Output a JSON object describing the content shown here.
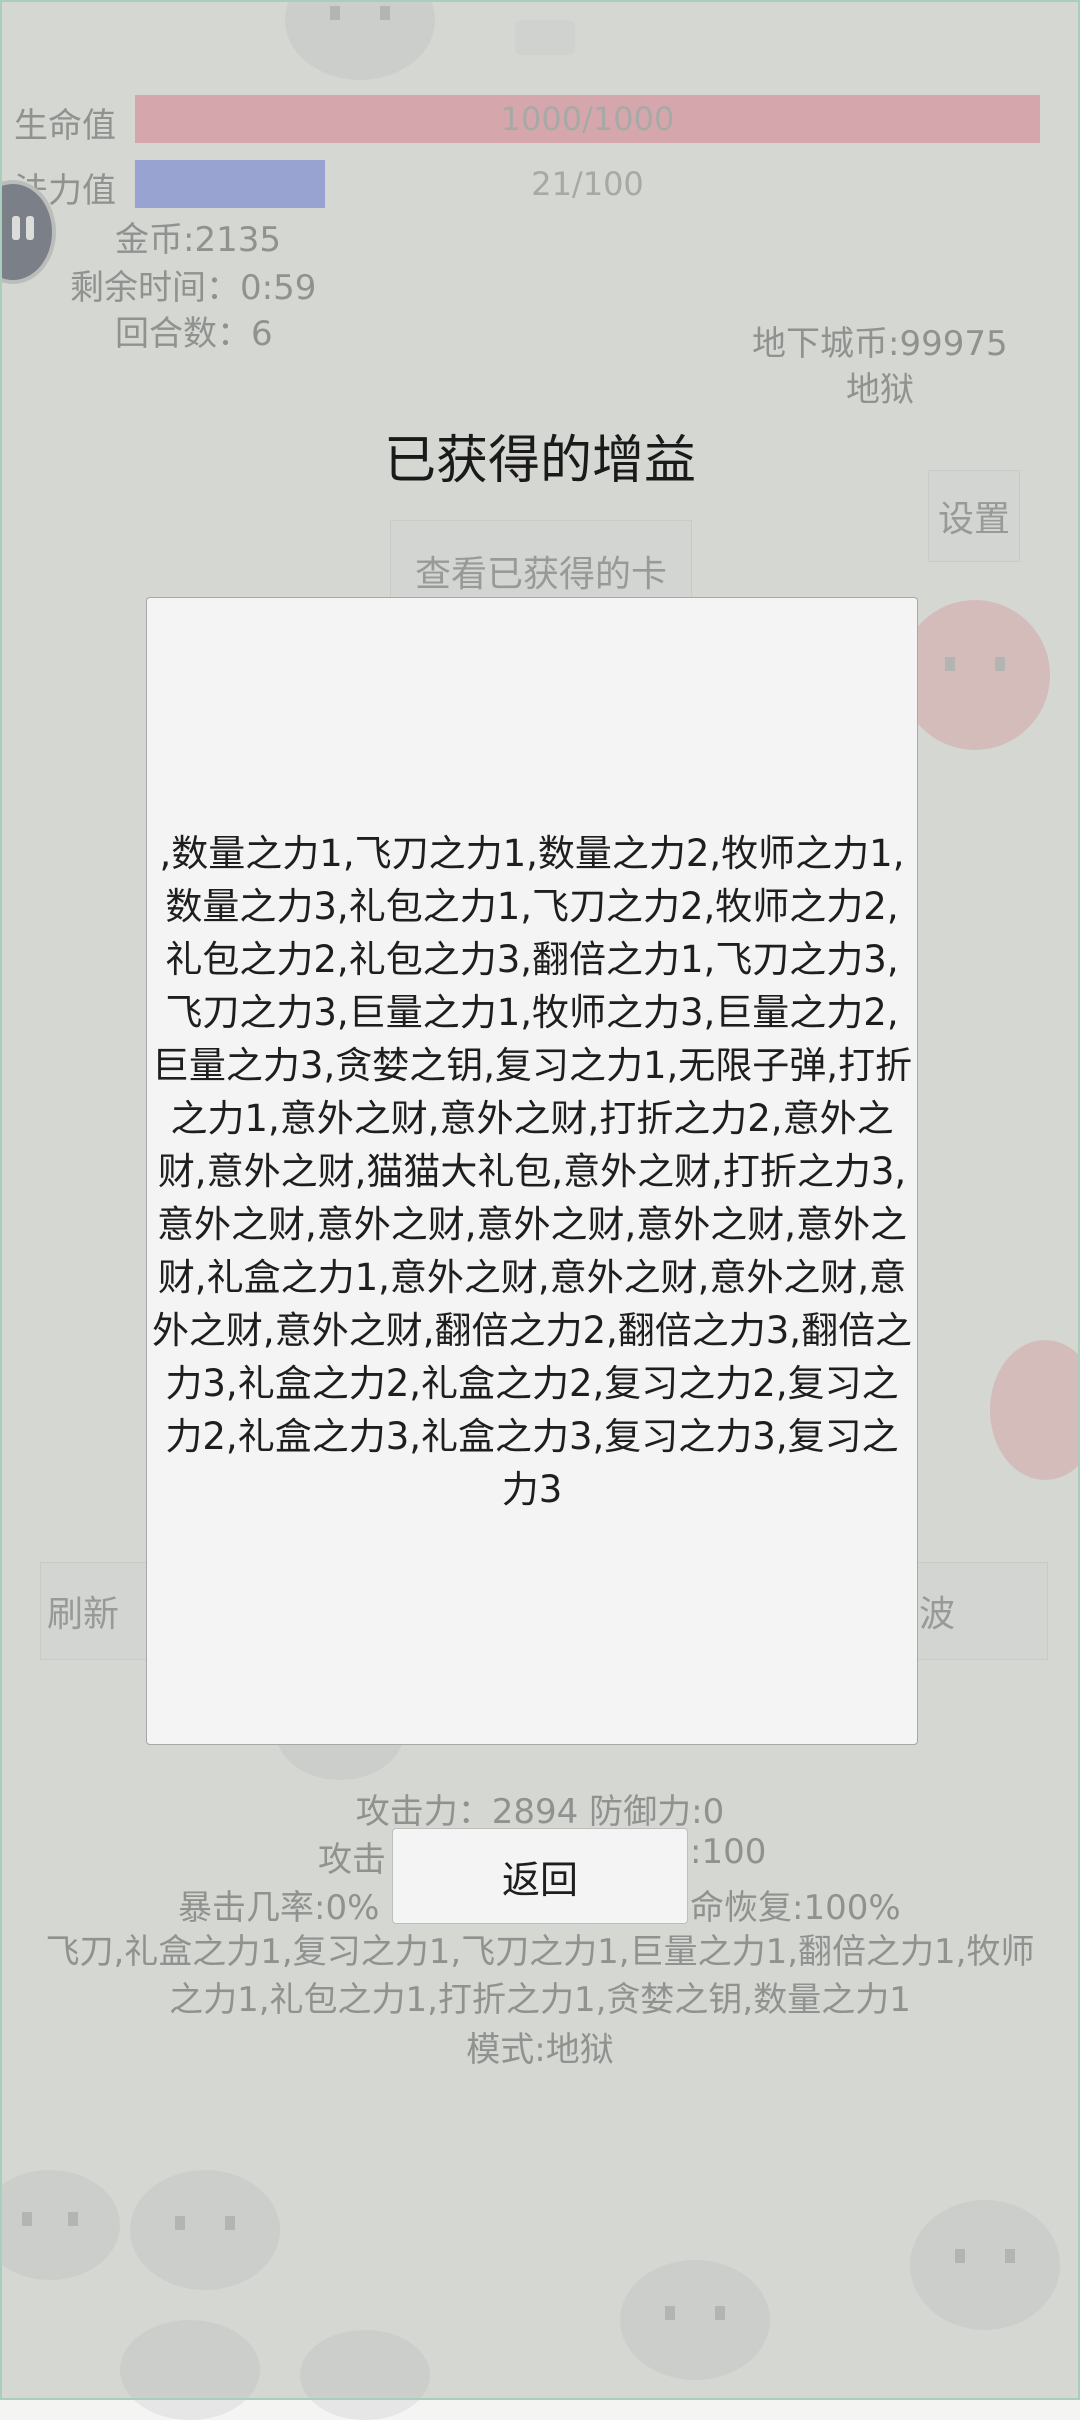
{
  "hud": {
    "hp_label": "生命值",
    "hp_text": "1000/1000",
    "hp_fraction": 1.0,
    "mp_label": "法力值",
    "mp_text": "21/100",
    "mp_fraction": 0.21,
    "gold": "金币:2135",
    "time_left": "剩余时间：0:59",
    "round": "回合数：6",
    "dungeon_coins": "地下城币:99975",
    "mode_short": "地狱"
  },
  "background": {
    "settings_label": "设置",
    "view_cards_label": "查看已获得的卡",
    "refresh_label": "刷新",
    "right_button_label": "波",
    "attack_line": "攻击力：2894 防御力:0",
    "speed_line_left": "攻击",
    "speed_line_right": ":100",
    "crit_line_left": "暴击几率:0%",
    "crit_line_right": "命恢复:100%",
    "skills_line": "飞刀,礼盒之力1,复习之力1,飞刀之力1,巨量之力1,翻倍之力1,牧师之力1,礼包之力1,打折之力1,贪婪之钥,数量之力1",
    "mode_line": "模式:地狱"
  },
  "dialog": {
    "title": "已获得的增益",
    "buffs_text": ",数量之力1,飞刀之力1,数量之力2,牧师之力1,数量之力3,礼包之力1,飞刀之力2,牧师之力2,礼包之力2,礼包之力3,翻倍之力1,飞刀之力3,飞刀之力3,巨量之力1,牧师之力3,巨量之力2,巨量之力3,贪婪之钥,复习之力1,无限子弹,打折之力1,意外之财,意外之财,打折之力2,意外之财,意外之财,猫猫大礼包,意外之财,打折之力3,意外之财,意外之财,意外之财,意外之财,意外之财,礼盒之力1,意外之财,意外之财,意外之财,意外之财,意外之财,翻倍之力2,翻倍之力3,翻倍之力3,礼盒之力2,礼盒之力2,复习之力2,复习之力2,礼盒之力3,礼盒之力3,复习之力3,复习之力3",
    "back_label": "返回"
  }
}
